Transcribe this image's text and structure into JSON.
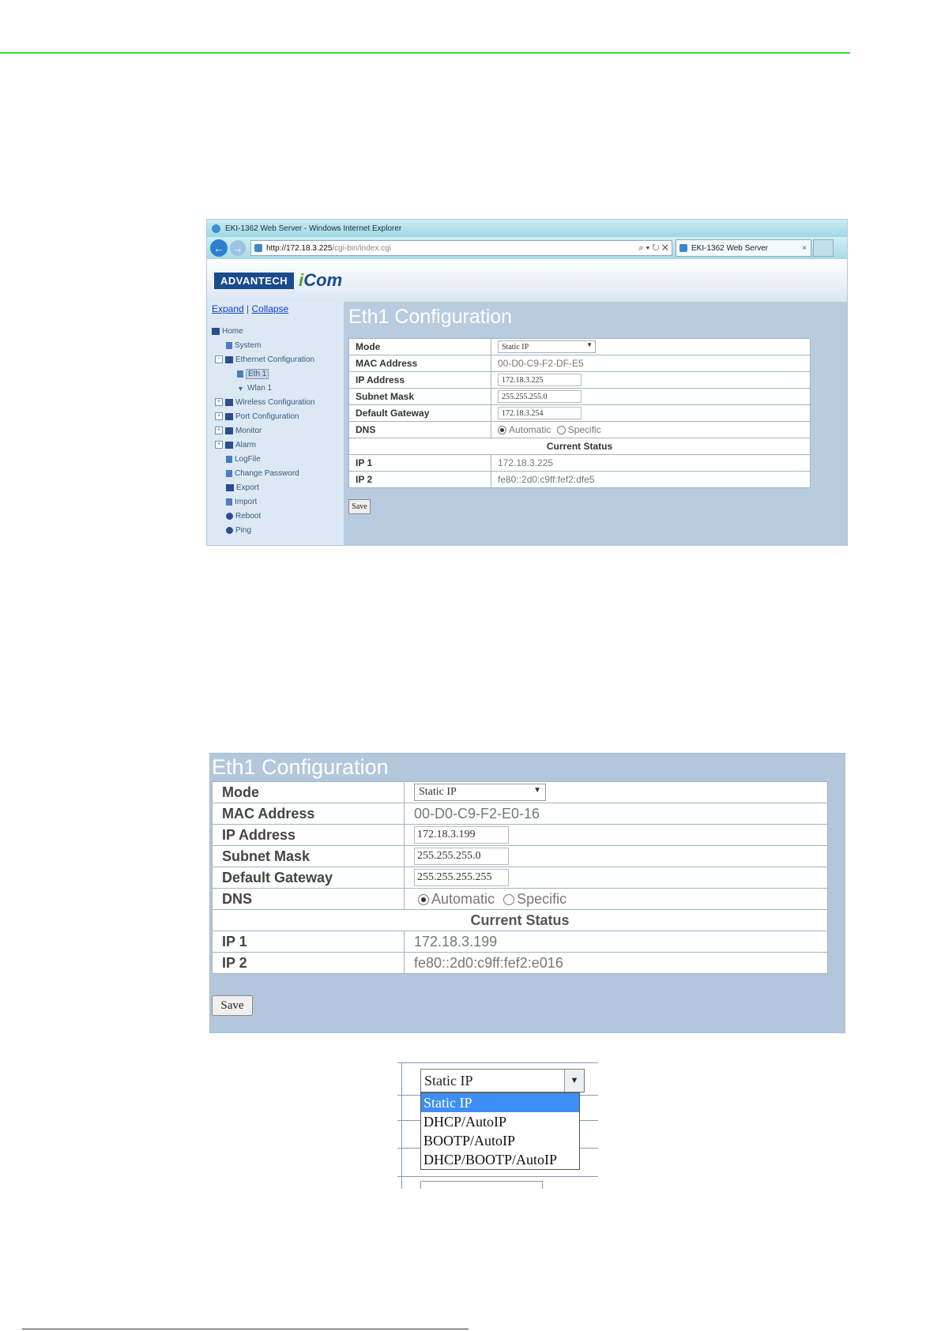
{
  "browser": {
    "window_title": "EKI-1362 Web Server - Windows Internet Explorer",
    "url_host": "http://172.18.3.225",
    "url_path": "/cgi-bin/index.cgi",
    "url_controls": "⌕ ▾ ↻ ✕",
    "tab_title": "EKI-1362 Web Server",
    "tab_close": "×",
    "logo_brand": "ADVANTECH",
    "logo_product": "Com",
    "logo_product_prefix": "i"
  },
  "sidebar": {
    "expand": "Expand",
    "separator": "|",
    "collapse": "Collapse",
    "items": [
      {
        "label": "Home"
      },
      {
        "label": "System"
      },
      {
        "label": "Ethernet Configuration"
      },
      {
        "label": "Eth 1"
      },
      {
        "label": "Wlan 1"
      },
      {
        "label": "Wireless Configuration"
      },
      {
        "label": "Port Configuration"
      },
      {
        "label": "Monitor"
      },
      {
        "label": "Alarm"
      },
      {
        "label": "LogFile"
      },
      {
        "label": "Change Password"
      },
      {
        "label": "Export"
      },
      {
        "label": "Import"
      },
      {
        "label": "Reboot"
      },
      {
        "label": "Ping"
      }
    ]
  },
  "config1": {
    "title": "Eth1 Configuration",
    "mode_label": "Mode",
    "mode_value": "Static IP",
    "mac_label": "MAC Address",
    "mac_value": "00-D0-C9-F2-DF-E5",
    "ip_label": "IP Address",
    "ip_value": "172.18.3.225",
    "subnet_label": "Subnet Mask",
    "subnet_value": "255.255.255.0",
    "gateway_label": "Default Gateway",
    "gateway_value": "172.18.3.254",
    "dns_label": "DNS",
    "dns_auto": "Automatic",
    "dns_specific": "Specific",
    "status_header": "Current Status",
    "ip1_label": "IP 1",
    "ip1_value": "172.18.3.225",
    "ip2_label": "IP 2",
    "ip2_value": "fe80::2d0:c9ff:fef2:dfe5",
    "save": "Save"
  },
  "config2": {
    "title": "Eth1 Configuration",
    "mode_label": "Mode",
    "mode_value": "Static IP",
    "mac_label": "MAC Address",
    "mac_value": "00-D0-C9-F2-E0-16",
    "ip_label": "IP Address",
    "ip_value": "172.18.3.199",
    "subnet_label": "Subnet Mask",
    "subnet_value": "255.255.255.0",
    "gateway_label": "Default Gateway",
    "gateway_value": "255.255.255.255",
    "dns_label": "DNS",
    "dns_auto": "Automatic",
    "dns_specific": "Specific",
    "status_header": "Current Status",
    "ip1_label": "IP 1",
    "ip1_value": "172.18.3.199",
    "ip2_label": "IP 2",
    "ip2_value": "fe80::2d0:c9ff:fef2:e016",
    "save": "Save"
  },
  "mode_dropdown": {
    "selected": "Static IP",
    "options": [
      "Static IP",
      "DHCP/AutoIP",
      "BOOTP/AutoIP",
      "DHCP/BOOTP/AutoIP"
    ]
  },
  "colors": {
    "top_rule": "#33dd33",
    "panel_bg": "#b3c7dc",
    "dropdown_highlight": "#3f8ef5"
  }
}
